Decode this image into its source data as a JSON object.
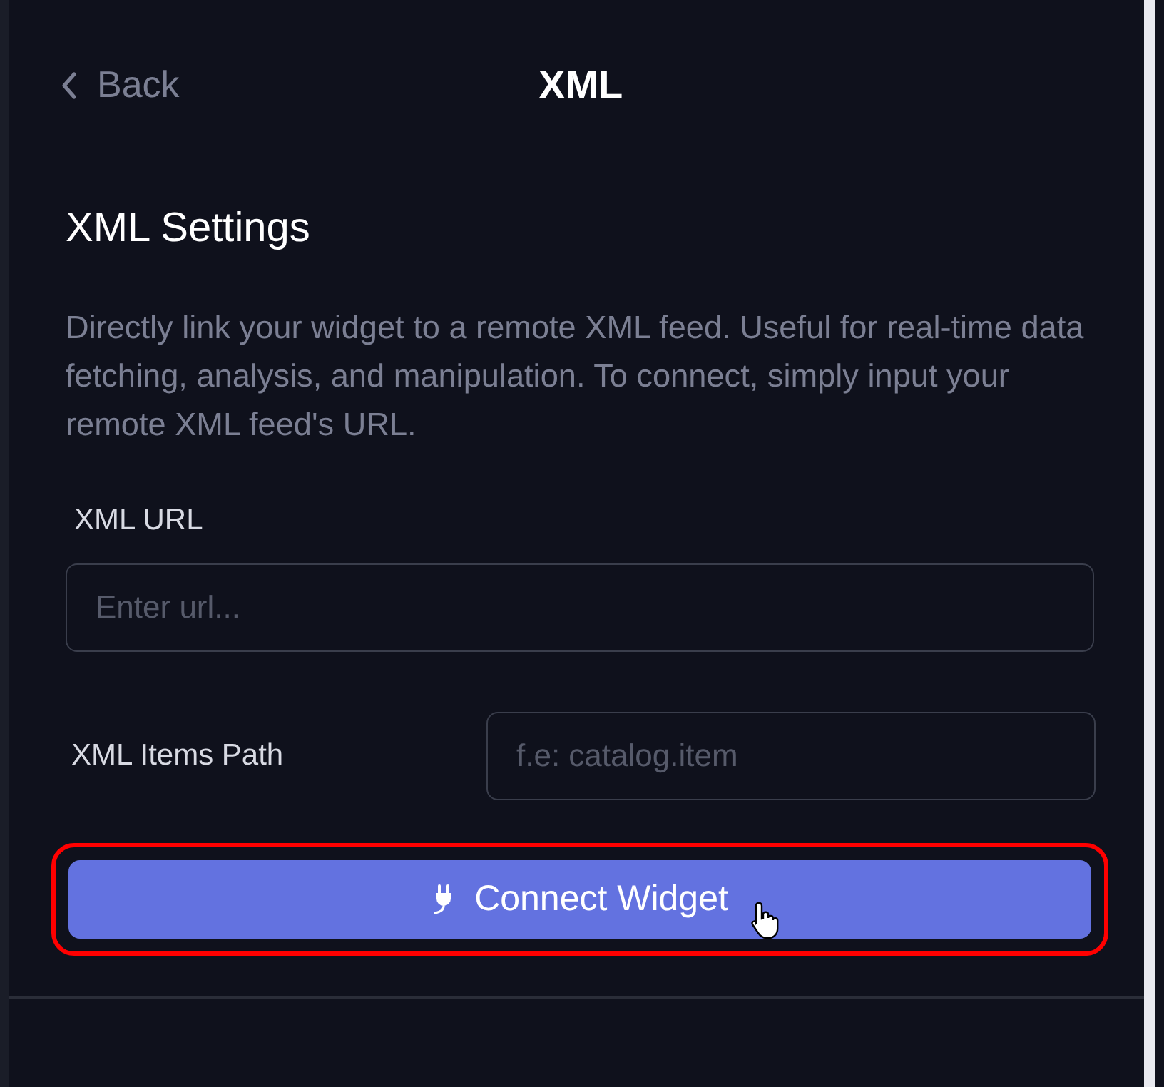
{
  "header": {
    "back": "Back",
    "title": "XML"
  },
  "section": {
    "heading": "XML Settings",
    "description": "Directly link your widget to a remote XML feed. Useful for real-time data fetching, analysis, and manipulation. To connect, simply input your remote XML feed's URL."
  },
  "fields": [
    {
      "kind": "stacked",
      "label": "XML URL",
      "placeholder": "Enter url..."
    },
    {
      "kind": "inline",
      "label": "XML Items Path",
      "placeholder": "f.e: catalog.item"
    }
  ],
  "button": {
    "label": "Connect Widget",
    "highlighted": true
  }
}
